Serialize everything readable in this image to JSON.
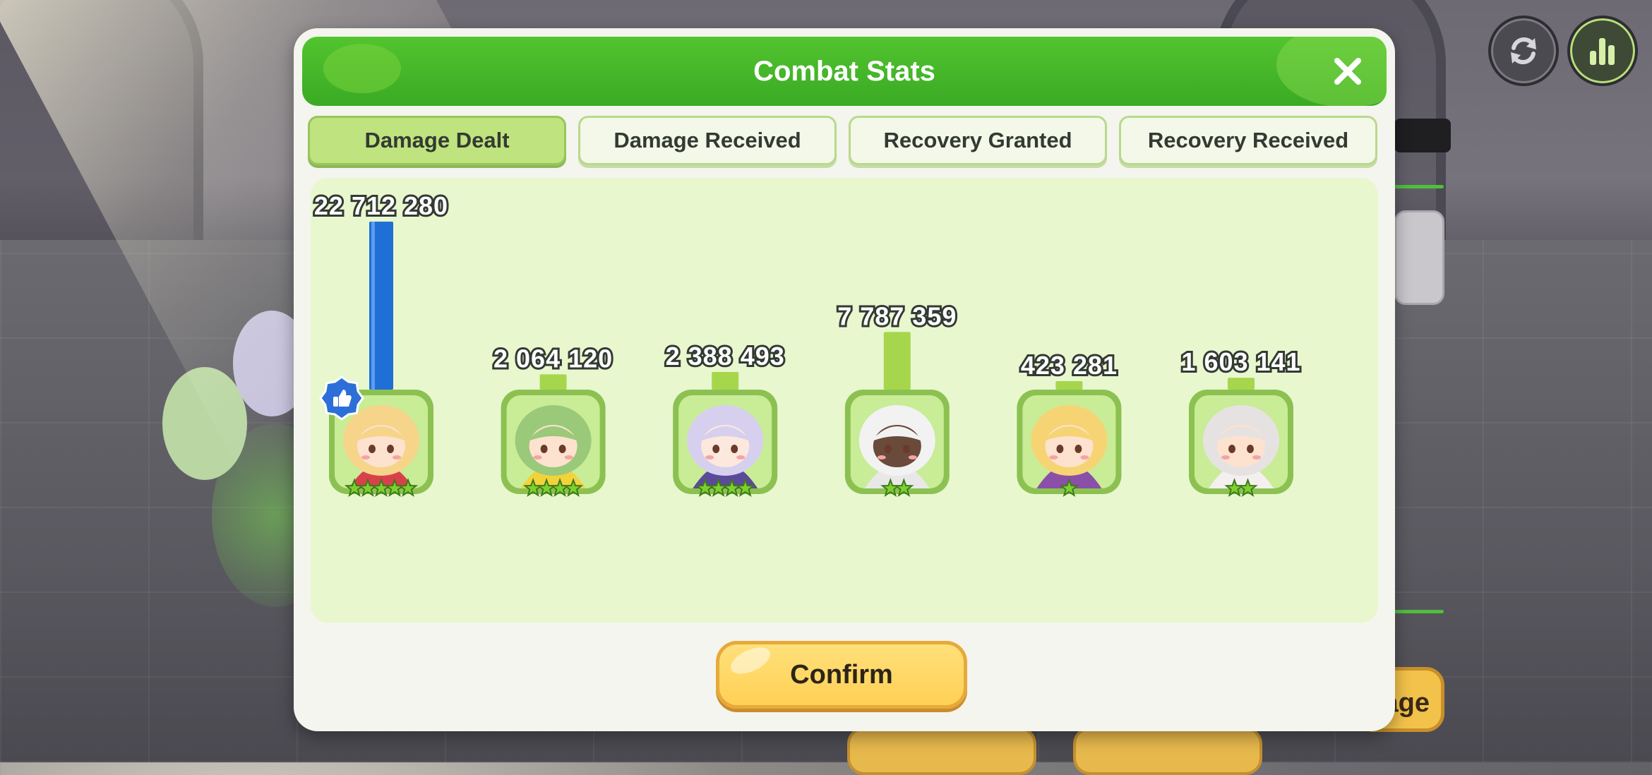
{
  "dialog": {
    "title": "Combat Stats",
    "close_icon": "close-icon"
  },
  "tabs": [
    {
      "label": "Damage Dealt",
      "active": true
    },
    {
      "label": "Damage Received",
      "active": false
    },
    {
      "label": "Recovery Granted",
      "active": false
    },
    {
      "label": "Recovery Received",
      "active": false
    }
  ],
  "chart_data": {
    "type": "bar",
    "values": [
      22712280,
      2064120,
      2388493,
      7787359,
      423281,
      1603141
    ],
    "value_labels": [
      "22 712 280",
      "2 064 120",
      "2 388 493",
      "7 787 359",
      "423 281",
      "1 603 141"
    ],
    "stars": [
      5,
      4,
      4,
      2,
      1,
      2
    ],
    "highlight_index": 0,
    "colors": {
      "highlight": "#1f6fd6",
      "normal": "#a6d64c"
    }
  },
  "heroes": [
    {
      "name": "hero-portrait-blonde-mage",
      "hair": "#f6d48a",
      "outfit": "#d9414a",
      "skin": "#fde2cf"
    },
    {
      "name": "hero-portrait-green-hair-girl",
      "hair": "#9bc97a",
      "outfit": "#f2d33a",
      "skin": "#fde2cf"
    },
    {
      "name": "hero-portrait-lavender-girl",
      "hair": "#d6d0ee",
      "outfit": "#5b4a9a",
      "skin": "#fde8dd"
    },
    {
      "name": "hero-portrait-white-hood-girl",
      "hair": "#f2f2f2",
      "outfit": "#e8e8e8",
      "skin": "#6a4a3a"
    },
    {
      "name": "hero-portrait-pink-hood-girl",
      "hair": "#f6d474",
      "outfit": "#8a4fa8",
      "skin": "#fde2cf"
    },
    {
      "name": "hero-portrait-silver-hair-girl",
      "hair": "#e7e2e2",
      "outfit": "#f4f0f0",
      "skin": "#fde2cf"
    }
  ],
  "mvp_badge": "thumbs-up-icon",
  "confirm_label": "Confirm",
  "top_buttons": {
    "refresh_icon": "refresh-icon",
    "stats_icon": "bar-chart-icon"
  },
  "background": {
    "stage_button_label": "age"
  }
}
